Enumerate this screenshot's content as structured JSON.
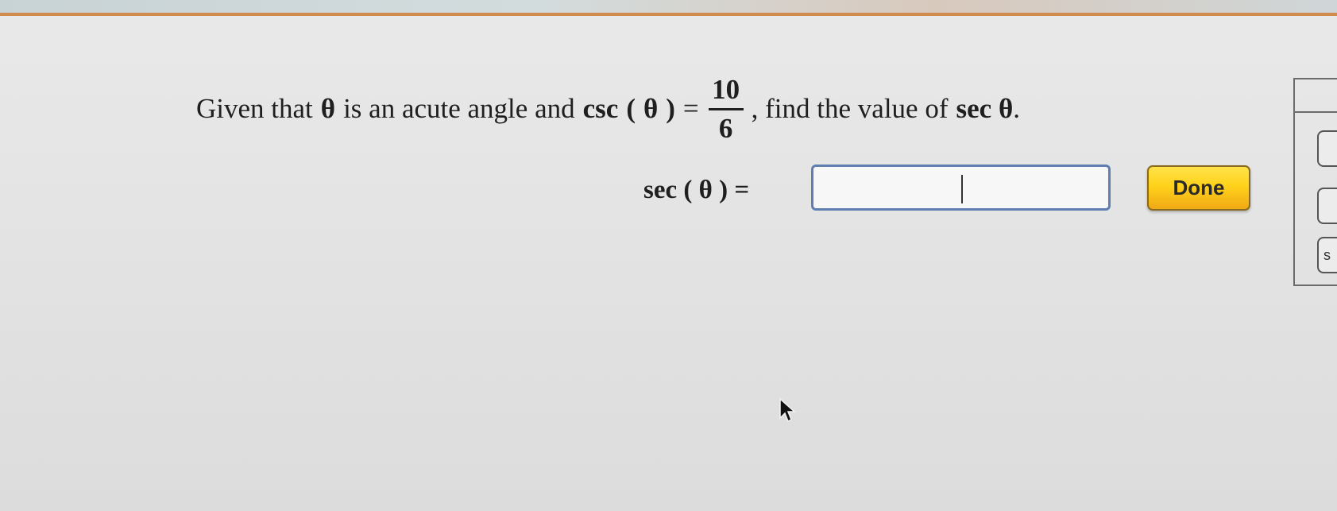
{
  "question": {
    "part1": "Given that",
    "theta": "θ",
    "part2": "is an acute angle and",
    "func": "csc",
    "lparen": "(",
    "rparen": ")",
    "equals": "=",
    "numerator": "10",
    "denominator": "6",
    "part3": ", find the value of",
    "target": "sec θ",
    "period": "."
  },
  "answer": {
    "label": "sec ( θ ) =",
    "value": "",
    "placeholder": ""
  },
  "done_button": {
    "label": "Done"
  },
  "side_panel": {
    "items": [
      "",
      "",
      "s"
    ]
  },
  "colors": {
    "accent_rule": "#cf8c4e",
    "input_border": "#5e7fb0",
    "done_gradient_top": "#ffe34a",
    "done_gradient_bottom": "#f0a915"
  }
}
